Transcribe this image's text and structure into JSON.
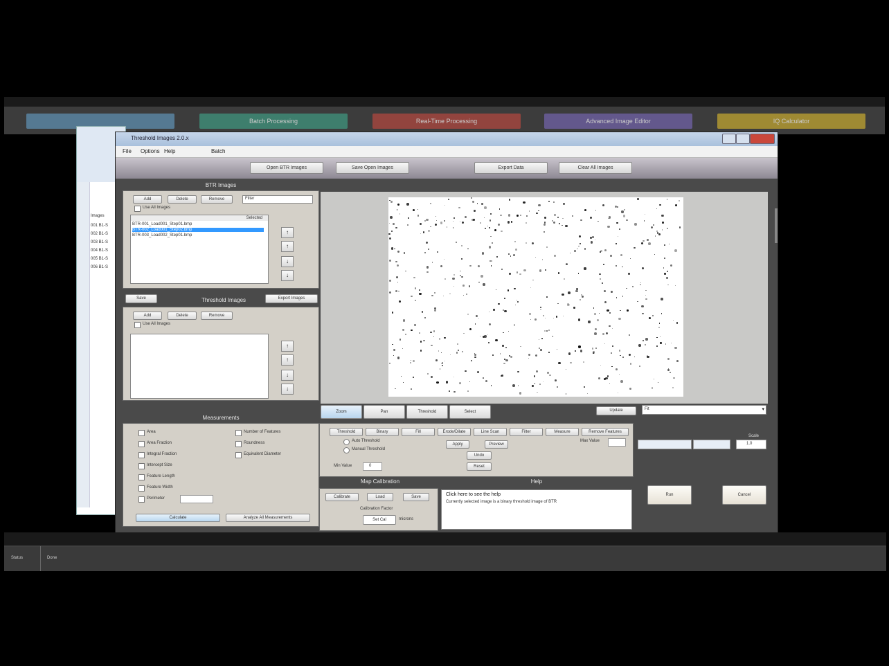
{
  "launcher": {
    "buttons": [
      {
        "label": "",
        "color": "#5b88a8"
      },
      {
        "label": "Batch Processing",
        "color": "#3f8f7a"
      },
      {
        "label": "Real-Time Processing",
        "color": "#a8473f"
      },
      {
        "label": "Advanced Image Editor",
        "color": "#6d5fa0"
      },
      {
        "label": "IQ Calculator",
        "color": "#b89e32"
      }
    ]
  },
  "excel": {
    "header": "Images",
    "rows": [
      "001 B1-S",
      "002 B1-S",
      "003 B1-S",
      "004 B1-S",
      "005 B1-S",
      "006 B1-S"
    ]
  },
  "app": {
    "title": "Threshold Images 2.0.x",
    "menu": [
      "File",
      "Options",
      "Help",
      "",
      "Batch"
    ],
    "toolbar": {
      "btn1": "Open BTR Images",
      "btn2": "Save Open Images",
      "btn3": "Export Data",
      "btn4": "Clear All Images"
    },
    "btr": {
      "heading": "BTR Images",
      "add": "Add",
      "remove": "Delete",
      "clear": "Remove",
      "filter": "Filter",
      "use_all": "Use All Images",
      "col_header": "Selected",
      "items": [
        "BTR-001_Load001_Step01.bmp",
        "BTR-002_Load001_Step02.bmp",
        "BTR-003_Load002_Step01.bmp"
      ],
      "selected_index": 1
    },
    "threshold": {
      "heading": "Threshold Images",
      "left_btn": "Save",
      "right_btn": "Export Images",
      "add": "Add",
      "remove": "Delete",
      "clear": "Remove",
      "use_all": "Use All Images"
    },
    "measurements": {
      "heading": "Measurements",
      "left": [
        "Area",
        "Area Fraction",
        "Integral Fraction",
        "Intercept Size",
        "Feature Length",
        "Feature Width",
        "Perimeter"
      ],
      "right": [
        "Number of Features",
        "Roundness",
        "Equivalent Diameter"
      ],
      "bottom_left": "Calculate",
      "bottom_right": "Analyze All Measurements"
    },
    "viewer": {
      "tools": [
        "Zoom",
        "Pan",
        "Threshold",
        "Select"
      ],
      "zoom_btn": "Update",
      "zoom_value": "Fit"
    },
    "tabs": [
      "Threshold",
      "Binary",
      "Fill",
      "Erode/Dilate",
      "Line Scan",
      "Filter",
      "Measure",
      "Remove Features"
    ],
    "controls": {
      "opt1": "Auto Threshold",
      "opt2": "Manual Threshold",
      "min_label": "Min Value",
      "min_value": "0",
      "max_label": "Max Value",
      "apply": "Apply",
      "preview": "Preview",
      "undo": "Undo",
      "reset": "Reset"
    },
    "map": {
      "heading": "Map Calibration",
      "calibrate": "Calibrate",
      "load": "Load",
      "save": "Save",
      "pixels_label": "Calibration Factor",
      "set": "Set Cal",
      "units": "microns"
    },
    "help": {
      "heading": "Help",
      "title": "Click here to see the help",
      "text": "Currently selected image is a binary threshold image of BTR"
    },
    "right": {
      "dropdown1": "",
      "dropdown2": "",
      "label": "Scale",
      "value": "1.0",
      "btn1": "Run",
      "btn2": "Cancel"
    }
  },
  "status": {
    "left": "Status",
    "text": "Done"
  }
}
